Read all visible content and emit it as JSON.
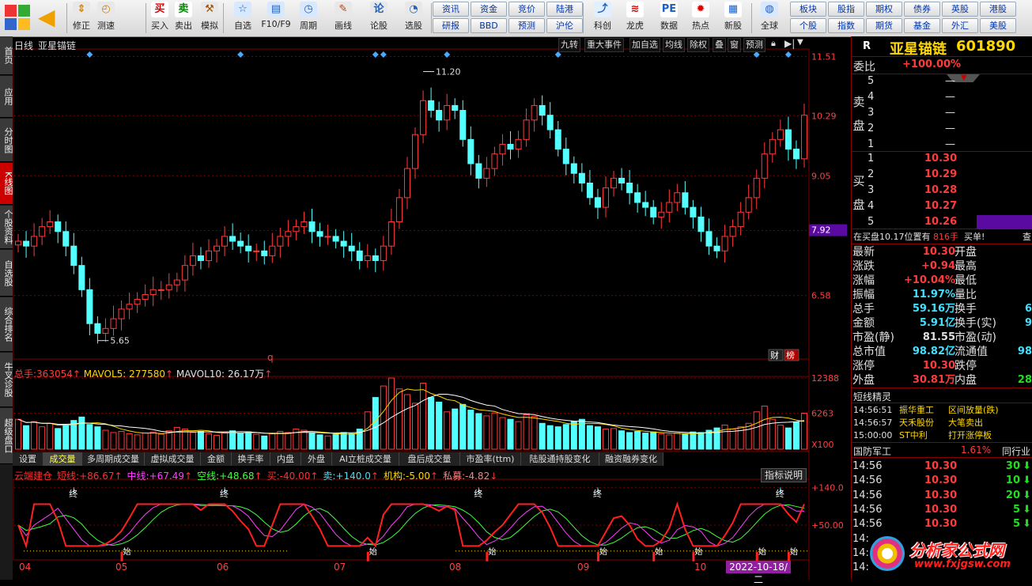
{
  "toolbar": {
    "buttons": [
      {
        "label": "修正",
        "icon": "up-down-arrows-icon"
      },
      {
        "label": "测速",
        "icon": "stopwatch-icon"
      },
      {
        "label": "买入",
        "icon": "buy-icon",
        "glyph": "买"
      },
      {
        "label": "卖出",
        "icon": "sell-icon",
        "glyph": "卖"
      },
      {
        "label": "模拟",
        "icon": "gavel-icon"
      },
      {
        "label": "自选",
        "icon": "star-folder-icon"
      },
      {
        "label": "F10/F9",
        "icon": "document-icon"
      },
      {
        "label": "周期",
        "icon": "clock-icon"
      },
      {
        "label": "画线",
        "icon": "pen-icon"
      },
      {
        "label": "论股",
        "icon": "forum-icon",
        "glyph": "论"
      },
      {
        "label": "选股",
        "icon": "chart-search-icon"
      },
      {
        "label": "科创",
        "icon": "rocket-icon"
      },
      {
        "label": "龙虎",
        "icon": "dragon-icon"
      },
      {
        "label": "数据",
        "icon": "pe-icon",
        "glyph": "PE"
      },
      {
        "label": "热点",
        "icon": "hot-icon"
      },
      {
        "label": "新股",
        "icon": "ipo-icon"
      },
      {
        "label": "全球",
        "icon": "globe-icon"
      }
    ],
    "mini_top": [
      "资讯",
      "资金",
      "竞价",
      "陆港",
      "板块",
      "股指",
      "期权",
      "债券",
      "英股",
      "港股"
    ],
    "mini_bottom": [
      "研报",
      "BBD",
      "预测",
      "沪伦",
      "个股",
      "指数",
      "期货",
      "基金",
      "外汇",
      "美股"
    ]
  },
  "left_tabs": [
    "首页",
    "应用",
    "分时图",
    "K线图",
    "个股资料",
    "自选股",
    "综合排名",
    "牛叉诊股",
    "超级盘口"
  ],
  "chart_header": {
    "period": "日线",
    "stock_name": "亚星锚链",
    "tags": [
      "九转",
      "重大事件",
      "加自选",
      "均线",
      "除权",
      "叠",
      "窗",
      "预测"
    ]
  },
  "kline": {
    "y_ticks": [
      "11.51",
      "10.29",
      "9.05",
      "7.92",
      "6.58"
    ],
    "current_price_tag": "7.92",
    "high_label": "11.20",
    "low_label": "5.65",
    "footer_tags": [
      "财",
      "榜"
    ]
  },
  "volume_header": {
    "total_label": "总手:",
    "total_value": "363054",
    "ma5_label": "MAVOL5:",
    "ma5_value": "277580",
    "ma10_label": "MAVOL10:",
    "ma10_value": "26.17万",
    "y_ticks": [
      "12388",
      "6263"
    ],
    "unit": "X100"
  },
  "indicator_tabs": [
    "设置",
    "成交量",
    "多周期成交量",
    "虚拟成交量",
    "金额",
    "换手率",
    "内盘",
    "外盘",
    "AI立桩成交量",
    "盘后成交量",
    "市盈率(ttm)",
    "陆股通持股变化",
    "融资融券变化"
  ],
  "indicator": {
    "name": "云端建仓",
    "items": [
      {
        "label": "短线:",
        "value": "+86.67",
        "color": "#ff3030"
      },
      {
        "label": "中线:",
        "value": "+67.49",
        "color": "#ff40ff"
      },
      {
        "label": "空线:",
        "value": "+48.68",
        "color": "#40ff40"
      },
      {
        "label": "买:",
        "value": "-40.00",
        "color": "#ff3030"
      },
      {
        "label": "卖:",
        "value": "+140.0",
        "color": "#40e0ff"
      },
      {
        "label": "机构:",
        "value": "-5.00",
        "color": "#ffd800"
      },
      {
        "label": "私募:",
        "value": "-4.82",
        "color": "#ff8080"
      }
    ],
    "help_button": "指标说明",
    "y_ticks": [
      "140.0",
      "50.00"
    ],
    "end_marker": "终",
    "start_marker": "始"
  },
  "x_axis": {
    "months": [
      "04",
      "05",
      "06",
      "07",
      "08",
      "09",
      "10"
    ],
    "date_tag": "2022-10-18/二"
  },
  "quote": {
    "market_flag": "R",
    "stock_name": "亚星锚链",
    "stock_code": "601890",
    "weibi_label": "委比",
    "weibi_value": "+100.00%",
    "sell_label": "卖盘",
    "buy_label": "买盘",
    "sell_levels": [
      {
        "level": "5",
        "price": "—"
      },
      {
        "level": "4",
        "price": "—"
      },
      {
        "level": "3",
        "price": "—"
      },
      {
        "level": "2",
        "price": "—"
      },
      {
        "level": "1",
        "price": "—"
      }
    ],
    "buy_levels": [
      {
        "level": "1",
        "price": "10.30"
      },
      {
        "level": "2",
        "price": "10.29"
      },
      {
        "level": "3",
        "price": "10.28"
      },
      {
        "level": "4",
        "price": "10.27"
      },
      {
        "level": "5",
        "price": "10.26"
      }
    ],
    "queue_text": "在买盘10.17位置有",
    "queue_count": "816手",
    "queue_action": "买单!",
    "queue_more": "查",
    "stats": [
      {
        "l1": "最新",
        "v1": "10.30",
        "c1": "red",
        "l2": "开盘"
      },
      {
        "l1": "涨跌",
        "v1": "+0.94",
        "c1": "red",
        "l2": "最高"
      },
      {
        "l1": "涨幅",
        "v1": "+10.04%",
        "c1": "red",
        "l2": "最低"
      },
      {
        "l1": "振幅",
        "v1": "11.97%",
        "c1": "cyan",
        "l2": "量比"
      },
      {
        "l1": "总手",
        "v1": "59.16万",
        "c1": "cyan",
        "l2": "换手",
        "v2": "6",
        "c2": "cyan"
      },
      {
        "l1": "金额",
        "v1": "5.91亿",
        "c1": "cyan",
        "l2": "换手(实)",
        "v2": "9",
        "c2": "cyan"
      },
      {
        "l1": "市盈(静)",
        "v1": "81.55",
        "c1": "white",
        "l2": "市盈(动)"
      },
      {
        "l1": "总市值",
        "v1": "98.82亿",
        "c1": "cyan",
        "l2": "流通值",
        "v2": "98",
        "c2": "cyan"
      },
      {
        "l1": "涨停",
        "v1": "10.30",
        "c1": "red",
        "l2": "跌停"
      },
      {
        "l1": "外盘",
        "v1": "30.81万",
        "c1": "red",
        "l2": "内盘",
        "v2": "28",
        "c2": "green"
      }
    ],
    "short_title": "短线精灵",
    "short_items": [
      {
        "time": "14:56:51",
        "name": "振华重工",
        "event": "区间放量(跌)"
      },
      {
        "time": "14:56:57",
        "name": "天禾股份",
        "event": "大笔卖出"
      },
      {
        "time": "15:00:00",
        "name": "ST中利",
        "event": "打开涨停板"
      }
    ],
    "sector_name": "国防军工",
    "sector_change": "1.61%",
    "sector_more": "同行业",
    "ticks": [
      {
        "time": "14:56",
        "price": "10.30",
        "vol": "30",
        "dir": "down"
      },
      {
        "time": "14:56",
        "price": "10.30",
        "vol": "10",
        "dir": "down"
      },
      {
        "time": "14:56",
        "price": "10.30",
        "vol": "20",
        "dir": "down"
      },
      {
        "time": "14:56",
        "price": "10.30",
        "vol": "5",
        "dir": "down"
      },
      {
        "time": "14:56",
        "price": "10.30",
        "vol": "5",
        "dir": "down"
      },
      {
        "time": "14:",
        "price": "",
        "vol": "",
        "dir": ""
      },
      {
        "time": "14:",
        "price": "",
        "vol": "",
        "dir": ""
      },
      {
        "time": "14:",
        "price": "",
        "vol": "",
        "dir": ""
      }
    ]
  },
  "watermark": {
    "title": "分析家公式网",
    "url": "www.fxjgsw.com"
  },
  "colors": {
    "up": "#ff3b3b",
    "down": "#54ffff",
    "grid": "#7a0000",
    "bg": "#000000"
  },
  "chart_data": {
    "type": "candlestick",
    "period": "日线",
    "ylim": [
      5.4,
      11.6
    ],
    "marked_high": 11.2,
    "marked_low": 5.65,
    "last_close": 10.3,
    "months": [
      "04",
      "05",
      "06",
      "07",
      "08",
      "09",
      "10"
    ],
    "close_series": [
      7.7,
      7.6,
      7.8,
      8.0,
      8.1,
      7.9,
      7.6,
      7.2,
      6.7,
      6.0,
      5.8,
      5.9,
      6.1,
      6.3,
      6.4,
      6.5,
      6.6,
      6.7,
      6.7,
      6.8,
      6.9,
      7.2,
      7.4,
      7.3,
      7.5,
      7.6,
      7.8,
      7.7,
      7.6,
      7.5,
      7.5,
      7.4,
      7.6,
      7.8,
      7.9,
      8.0,
      8.1,
      7.9,
      7.8,
      7.8,
      7.7,
      7.6,
      7.5,
      7.3,
      7.4,
      7.3,
      7.6,
      8.1,
      8.6,
      9.2,
      9.9,
      10.6,
      10.4,
      10.2,
      10.5,
      10.4,
      9.8,
      9.3,
      9.0,
      9.2,
      9.5,
      9.7,
      9.6,
      9.8,
      10.2,
      10.5,
      10.3,
      10.0,
      9.6,
      9.3,
      9.1,
      8.9,
      8.6,
      8.4,
      8.8,
      9.0,
      8.9,
      8.7,
      8.5,
      8.4,
      8.2,
      8.3,
      8.5,
      8.7,
      8.4,
      8.2,
      7.9,
      7.6,
      7.5,
      7.8,
      8.0,
      8.3,
      8.6,
      9.0,
      9.5,
      9.8,
      10.0,
      9.6,
      9.4,
      10.3
    ],
    "volume": [
      5200,
      4100,
      4800,
      3900,
      4500,
      3600,
      4200,
      5000,
      5600,
      4300,
      3900,
      3300,
      2900,
      3100,
      2700,
      2500,
      2800,
      3000,
      2600,
      3200,
      3800,
      3500,
      2900,
      3100,
      2700,
      2400,
      2900,
      3200,
      2800,
      3000,
      2600,
      2300,
      2700,
      3100,
      2900,
      3500,
      3300,
      2800,
      2500,
      2300,
      2600,
      2900,
      2700,
      3500,
      6500,
      9000,
      11000,
      12388,
      10500,
      9500,
      8000,
      11500,
      9000,
      8200,
      6500,
      7000,
      7800,
      6800,
      6200,
      5800,
      6300,
      5500,
      5200,
      4800,
      6000,
      5700,
      4500,
      4100,
      3900,
      4300,
      4800,
      5200,
      4100,
      3900,
      3500,
      3600,
      3200,
      2900,
      3100,
      2800,
      3000,
      2700,
      2500,
      2800,
      2600,
      3000,
      2900,
      3300,
      3700,
      4200,
      3500,
      3900,
      4500,
      6500,
      7500,
      5200,
      4200,
      3700,
      4700,
      6263
    ],
    "volume_ma5_last": 277580,
    "volume_ma10_last": 261700,
    "indicator_short_last": 86.67,
    "indicator_mid_last": 67.49,
    "indicator_empty_last": 48.68
  }
}
